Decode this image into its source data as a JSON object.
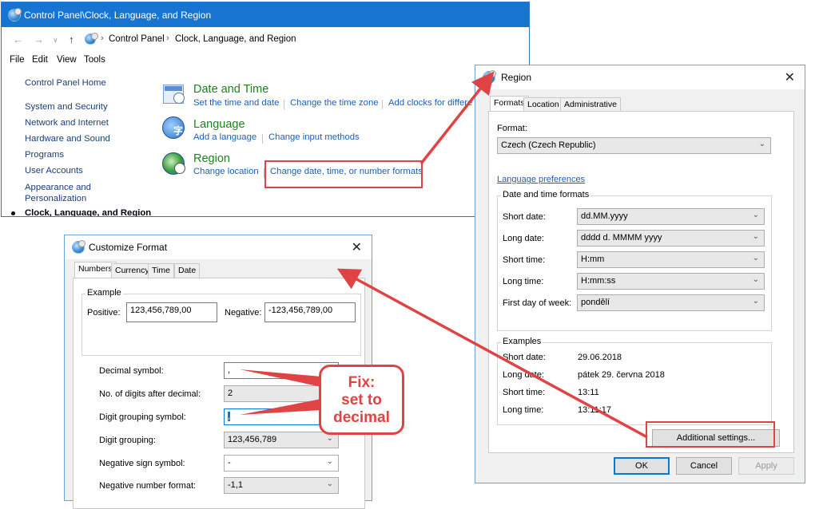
{
  "control_panel": {
    "title": "Control Panel\\Clock, Language, and Region",
    "breadcrumb": [
      "Control Panel",
      "Clock, Language, and Region"
    ],
    "menu": [
      "File",
      "Edit",
      "View",
      "Tools"
    ],
    "left_nav": [
      "Control Panel Home",
      "System and Security",
      "Network and Internet",
      "Hardware and Sound",
      "Programs",
      "User Accounts",
      "Appearance and",
      "Personalization",
      "Clock, Language, and Region"
    ],
    "categories": [
      {
        "title": "Date and Time",
        "links": [
          "Set the time and date",
          "Change the time zone",
          "Add clocks for differe"
        ]
      },
      {
        "title": "Language",
        "links": [
          "Add a language",
          "Change input methods"
        ]
      },
      {
        "title": "Region",
        "links": [
          "Change location",
          "Change date, time, or number formats"
        ]
      }
    ]
  },
  "region_dialog": {
    "title": "Region",
    "tabs": [
      "Formats",
      "Location",
      "Administrative"
    ],
    "format_label": "Format:",
    "format_value": "Czech (Czech Republic)",
    "language_preferences": "Language preferences",
    "datetime_group": "Date and time formats",
    "rows": [
      {
        "label": "Short date:",
        "value": "dd.MM.yyyy"
      },
      {
        "label": "Long date:",
        "value": "dddd d. MMMM yyyy"
      },
      {
        "label": "Short time:",
        "value": "H:mm"
      },
      {
        "label": "Long time:",
        "value": "H:mm:ss"
      },
      {
        "label": "First day of week:",
        "value": "pondělí"
      }
    ],
    "examples_group": "Examples",
    "examples": [
      {
        "label": "Short date:",
        "value": "29.06.2018"
      },
      {
        "label": "Long date:",
        "value": "pátek 29. června 2018"
      },
      {
        "label": "Short time:",
        "value": "13:11"
      },
      {
        "label": "Long time:",
        "value": "13:11:17"
      }
    ],
    "additional_settings": "Additional settings...",
    "ok": "OK",
    "cancel": "Cancel",
    "apply": "Apply"
  },
  "customize_dialog": {
    "title": "Customize Format",
    "tabs": [
      "Numbers",
      "Currency",
      "Time",
      "Date"
    ],
    "example_group": "Example",
    "positive_label": "Positive:",
    "positive_value": "123,456,789,00",
    "negative_label": "Negative:",
    "negative_value": "-123,456,789,00",
    "rows": [
      {
        "label": "Decimal symbol:",
        "value": ","
      },
      {
        "label": "No. of digits after decimal:",
        "value": "2"
      },
      {
        "label": "Digit grouping symbol:",
        "value": ","
      },
      {
        "label": "Digit grouping:",
        "value": "123,456,789"
      },
      {
        "label": "Negative sign symbol:",
        "value": "-"
      },
      {
        "label": "Negative number format:",
        "value": "-1,1"
      }
    ]
  },
  "annotation": {
    "callout_lines": [
      "Fix:",
      "set to",
      "decimal"
    ],
    "color": "#e04343"
  }
}
